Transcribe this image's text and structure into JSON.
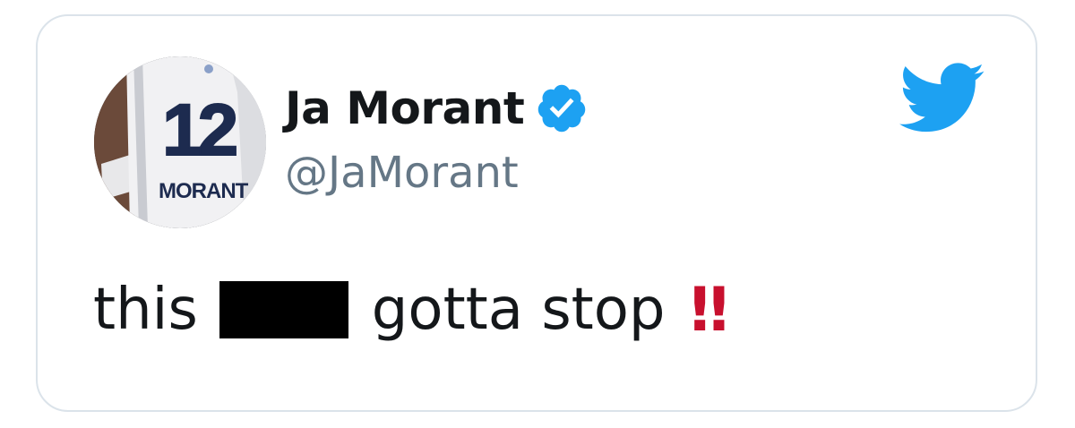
{
  "tweet_card": {
    "display_name": "Ja Morant",
    "handle": "@JaMorant",
    "text_before": "this",
    "text_after": "gotta stop",
    "emoji": "‼"
  },
  "avatar": {
    "jersey_number": "12",
    "jersey_name": "MORANT"
  },
  "icons": {
    "verified": "verified-badge-icon",
    "brand": "twitter-bird-icon"
  },
  "colors": {
    "brand_blue": "#1da1f2",
    "handle_gray": "#657786",
    "text_dark": "#14171a",
    "emoji_red": "#c8102e",
    "card_border": "#dbe3ea"
  }
}
